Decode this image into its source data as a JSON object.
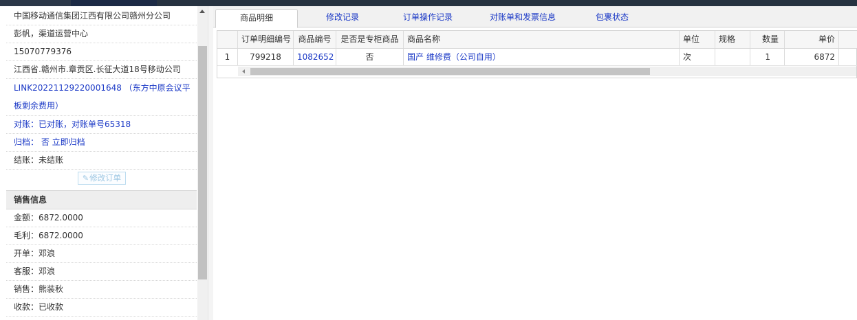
{
  "order_info": {
    "company": "中国移动通信集团江西有限公司赣州分公司",
    "contact": "彭帆，渠道运营中心",
    "phone": "15070779376",
    "address": "江西省.赣州市.章贡区.长征大道18号移动公司",
    "link_text": "LINK20221129220001648 （东方中原会议平板剩余费用）",
    "reconcile": "对账：已对账，对账单号65318",
    "archive": "归档： 否 立即归档",
    "settle": "结账：未结账",
    "edit_button": "修改订单",
    "edit_icon": "edit-icon"
  },
  "sales_info": {
    "heading": "销售信息",
    "amount": "金额：6872.0000",
    "gross_profit": "毛利：6872.0000",
    "opener": "开单：邓浪",
    "service": "客服：邓浪",
    "sales": "销售：熊装秋",
    "payment": "收款：已收款"
  },
  "tabs": [
    {
      "label": "商品明细",
      "active": true
    },
    {
      "label": "修改记录",
      "active": false
    },
    {
      "label": "订单操作记录",
      "active": false
    },
    {
      "label": "对账单和发票信息",
      "active": false
    },
    {
      "label": "包裹状态",
      "active": false
    }
  ],
  "grid": {
    "columns": [
      "订单明细编号",
      "商品编号",
      "是否是专柜商品",
      "商品名称",
      "单位",
      "规格",
      "数量",
      "单价"
    ],
    "rows": [
      {
        "index": "1",
        "detail_id": "799218",
        "product_id": "1082652",
        "is_counter": "否",
        "product_name": "国产 维修费（公司自用）",
        "unit": "次",
        "spec": "",
        "quantity": "1",
        "price": "6872"
      }
    ]
  },
  "colors": {
    "link": "#1a38c6",
    "topbar": "#2a3542",
    "section_bg": "#eeeeee"
  }
}
